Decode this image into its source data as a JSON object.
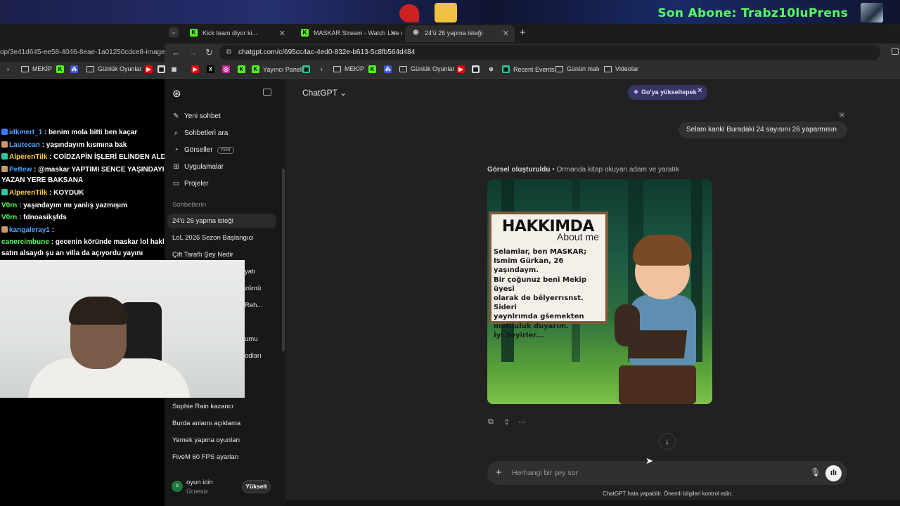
{
  "stream_overlay": {
    "last_sub_text": "Son Abone: Trabz10luPrens"
  },
  "browser": {
    "tabs": [
      {
        "label": "Kick team diyor ki..."
      },
      {
        "label": "MASKAR Stream - Watch Live o"
      },
      {
        "label": "24'ü 26 yapma isteği"
      }
    ],
    "left_url": "op/3e41d645-ee58-4046-8eae-1a01250cdce8-image.web",
    "url": "chatgpt.com/c/695cc4ac-4ed0-832e-b613-5c8fb564d484",
    "bookmarks_left": [
      "MEKİP",
      "Günlük Oyunlar"
    ],
    "bookmarks": [
      "Yayıncı Paneli",
      "MEKİP",
      "Günlük Oyunlar",
      "Recent Events",
      "Günün malı",
      "Videolar"
    ]
  },
  "stream_chat": [
    {
      "user": "idkmert_1",
      "color": "#4da3ff",
      "msg": ": benim mola bitti ben kaçar"
    },
    {
      "user": "Lautecan",
      "color": "#4da3ff",
      "msg": ": yaşındayım kısmına bak"
    },
    {
      "user": "AlperenTilk",
      "color": "#ffcf3f",
      "msg": ": COİDZAPİN İŞLERİ ELİNDEN ALDIK"
    },
    {
      "user": "Pettew",
      "color": "#4da3ff",
      "msg": ": @maskar YAPTIMI SENCE YAŞINDAYIM"
    },
    {
      "user": "",
      "color": "#fff",
      "msg": "YAZAN YERE BAKSANA"
    },
    {
      "user": "AlperenTilk",
      "color": "#ffcf3f",
      "msg": ": KOYDUK"
    },
    {
      "user": "V0rn",
      "color": "#57ff63",
      "msg": ": yaşındayım mı yanlış yazmışım"
    },
    {
      "user": "V0rn",
      "color": "#57ff63",
      "msg": ": fdnoasikşfds"
    },
    {
      "user": "kangaleray1",
      "color": "#4da3ff",
      "msg": ":"
    },
    {
      "user": "canercimbune",
      "color": "#57ff63",
      "msg": ": gecenin köründe maskar lol haklarını"
    },
    {
      "user": "",
      "color": "#fff",
      "msg": "satın alsaydı şu an villa da açıyordu yayını"
    }
  ],
  "sidebar": {
    "nav": [
      {
        "label": "Yeni sohbet",
        "icon": "edit-icon"
      },
      {
        "label": "Sohbetleri ara",
        "icon": "search-icon"
      },
      {
        "label": "Görseller",
        "icon": "image-icon",
        "badge": "YENİ"
      },
      {
        "label": "Uygulamalar",
        "icon": "apps-icon"
      },
      {
        "label": "Projeler",
        "icon": "folder-icon"
      }
    ],
    "section_title": "Sohbetlerin",
    "chats": [
      "24'ü 26 yapma isteği",
      "LoL 2026 Sezon Başlangıcı",
      "Çift Taraflı Şey Nedir"
    ],
    "chats_partial": [
      "yatı",
      "zümü",
      "Reh...",
      "umu",
      "odları"
    ],
    "chats_bottom": [
      "Sophie Rain kazancı",
      "Burda anlamı açıklama",
      "Yemek yapma oyunları",
      "FiveM 60 FPS ayarları"
    ],
    "user": {
      "initial": "o",
      "name": "oyun icin",
      "plan": "Ücretsiz",
      "upgrade_label": "Yükselt"
    }
  },
  "main": {
    "model_label": "ChatGPT",
    "go_upgrade_label": "Go'ya yükseltерek",
    "user_message": "Selam kanki Buradaki 24 sayısını 26 yaparmısın",
    "image_caption_bold": "Görsel oluşturuldu",
    "image_caption_rest": " • Ormanda kitap okuyan adam ve yaratık",
    "card_title": "HAKKIMDA",
    "card_subtitle": "About me",
    "card_body": "Selamlar, ben MASKAR;\nIsmim Gürkan, 26 yaşındaym.\nBir çoğunuz beni Mekip üyesi\nolarak de bêlyerrısnst. Sideri\nyaynlrımda gšemekten\nmutiluluk duyarım.\nİyi Seyirler...",
    "composer_placeholder": "Herhangi bir şey sor",
    "disclaimer": "ChatGPT hata yapabilir. Önemli bilgileri kontrol edin."
  }
}
